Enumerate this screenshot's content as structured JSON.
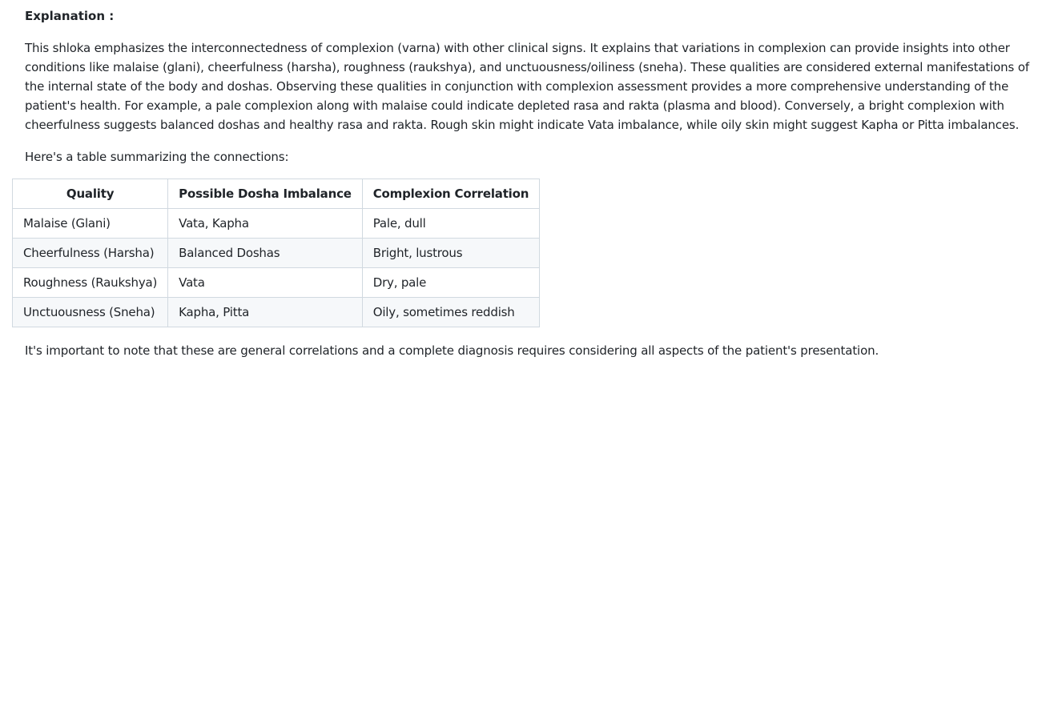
{
  "heading": "Explanation :",
  "paragraphs": {
    "main": "This shloka emphasizes the interconnectedness of complexion (varna) with other clinical signs. It explains that variations in complexion can provide insights into other conditions like malaise (glani), cheerfulness (harsha), roughness (raukshya), and unctuousness/oiliness (sneha). These qualities are considered external manifestations of the internal state of the body and doshas. Observing these qualities in conjunction with complexion assessment provides a more comprehensive understanding of the patient's health. For example, a pale complexion along with malaise could indicate depleted rasa and rakta (plasma and blood). Conversely, a bright complexion with cheerfulness suggests balanced doshas and healthy rasa and rakta. Rough skin might indicate Vata imbalance, while oily skin might suggest Kapha or Pitta imbalances.",
    "intro": "Here's a table summarizing the connections:",
    "note": "It's important to note that these are general correlations and a complete diagnosis requires considering all aspects of the patient's presentation."
  },
  "table": {
    "headers": [
      "Quality",
      "Possible Dosha Imbalance",
      "Complexion Correlation"
    ],
    "rows": [
      [
        "Malaise (Glani)",
        "Vata, Kapha",
        "Pale, dull"
      ],
      [
        "Cheerfulness (Harsha)",
        "Balanced Doshas",
        "Bright, lustrous"
      ],
      [
        "Roughness (Raukshya)",
        "Vata",
        "Dry, pale"
      ],
      [
        "Unctuousness (Sneha)",
        "Kapha, Pitta",
        "Oily, sometimes reddish"
      ]
    ]
  },
  "colors": {
    "text": "#1f2328",
    "table_border": "#d1d9e0",
    "alt_row": "#f6f8fa"
  }
}
